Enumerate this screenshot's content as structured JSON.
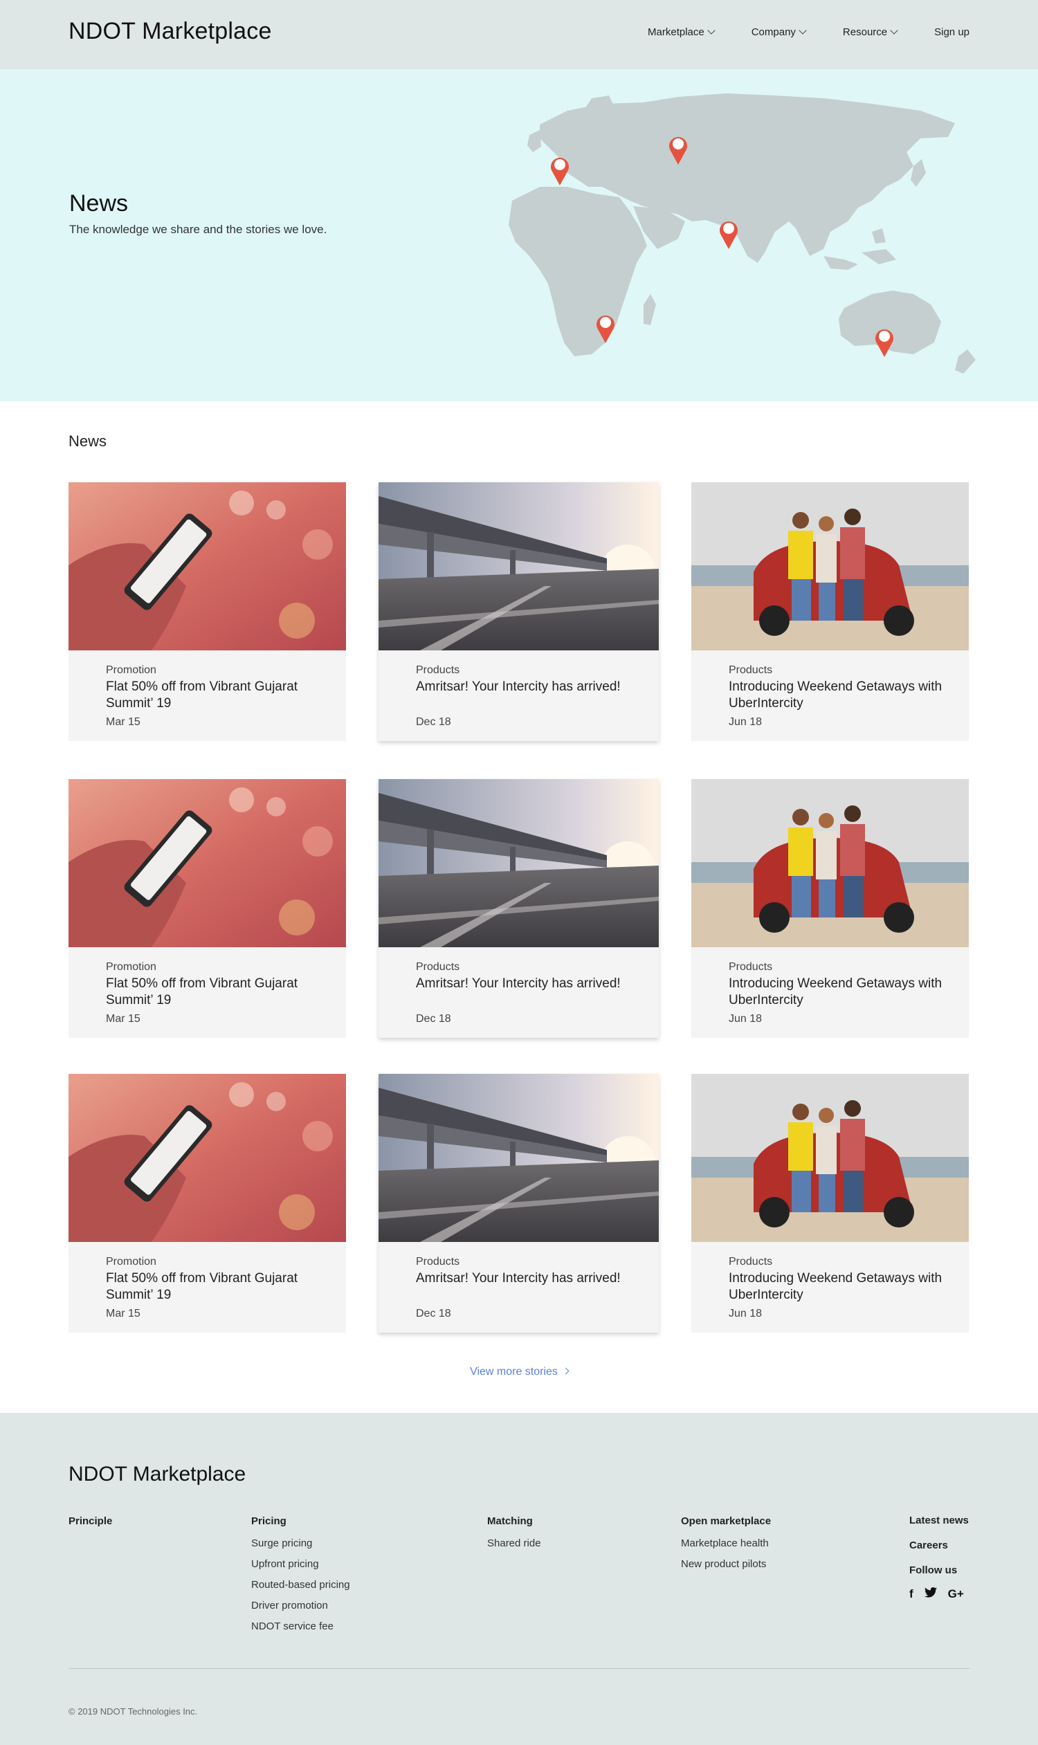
{
  "header": {
    "logo_bold": "NDOT",
    "logo_rest": " Marketplace",
    "nav": [
      {
        "label": "Marketplace"
      },
      {
        "label": "Company"
      },
      {
        "label": "Resource"
      },
      {
        "label": "Sign up"
      }
    ]
  },
  "hero": {
    "title": "News",
    "subtitle": "The knowledge we share and the stories we love."
  },
  "news": {
    "section_title": "News",
    "cards": [
      {
        "category": "Promotion",
        "title": "Flat 50% off from Vibrant Gujarat Summit’ 19",
        "date": "Mar 15",
        "image": "phone-hand-photo"
      },
      {
        "category": "Products",
        "title": "Amritsar! Your Intercity has arrived!",
        "date": "Dec 18",
        "image": "highway-bridge-photo"
      },
      {
        "category": "Products",
        "title": "Introducing Weekend Getaways with UberIntercity",
        "date": "Jun 18",
        "image": "friends-car-beach-photo"
      },
      {
        "category": "Promotion",
        "title": "Flat 50% off from Vibrant Gujarat Summit’ 19",
        "date": "Mar 15",
        "image": "phone-hand-photo"
      },
      {
        "category": "Products",
        "title": "Amritsar! Your Intercity has arrived!",
        "date": "Dec 18",
        "image": "highway-bridge-photo"
      },
      {
        "category": "Products",
        "title": "Introducing Weekend Getaways with UberIntercity",
        "date": "Jun 18",
        "image": "friends-car-beach-photo"
      },
      {
        "category": "Promotion",
        "title": "Flat 50% off from Vibrant Gujarat Summit’ 19",
        "date": "Mar 15",
        "image": "phone-hand-photo"
      },
      {
        "category": "Products",
        "title": "Amritsar! Your Intercity has arrived!",
        "date": "Dec 18",
        "image": "highway-bridge-photo"
      },
      {
        "category": "Products",
        "title": "Introducing Weekend Getaways with UberIntercity",
        "date": "Jun 18",
        "image": "friends-car-beach-photo"
      }
    ],
    "view_more": "View more stories"
  },
  "footer": {
    "logo_bold": "NDOT",
    "logo_rest": " Marketplace",
    "columns": [
      {
        "heading": "Principle",
        "links": []
      },
      {
        "heading": "Pricing",
        "links": [
          "Surge pricing",
          "Upfront pricing",
          "Routed-based pricing",
          "Driver promotion",
          "NDOT service fee"
        ]
      },
      {
        "heading": "Matching",
        "links": [
          "Shared ride"
        ]
      },
      {
        "heading": "Open marketplace",
        "links": [
          "Marketplace health",
          "New product pilots"
        ]
      }
    ],
    "right_links": [
      "Latest news",
      "Careers",
      "Follow us"
    ],
    "social_icons": [
      "facebook-icon",
      "twitter-icon",
      "google-plus-icon"
    ],
    "social_glyphs": [
      "f",
      "🐦",
      "G+"
    ],
    "copyright": "© 2019 NDOT Technologies Inc."
  },
  "colors": {
    "header_bg": "#dfe6e6",
    "hero_bg": "#e0f7f7",
    "map_land": "#c5cfcf",
    "pin": "#e5533f",
    "card_bg": "#f4f4f4",
    "link_blue": "#5b7fd8"
  }
}
